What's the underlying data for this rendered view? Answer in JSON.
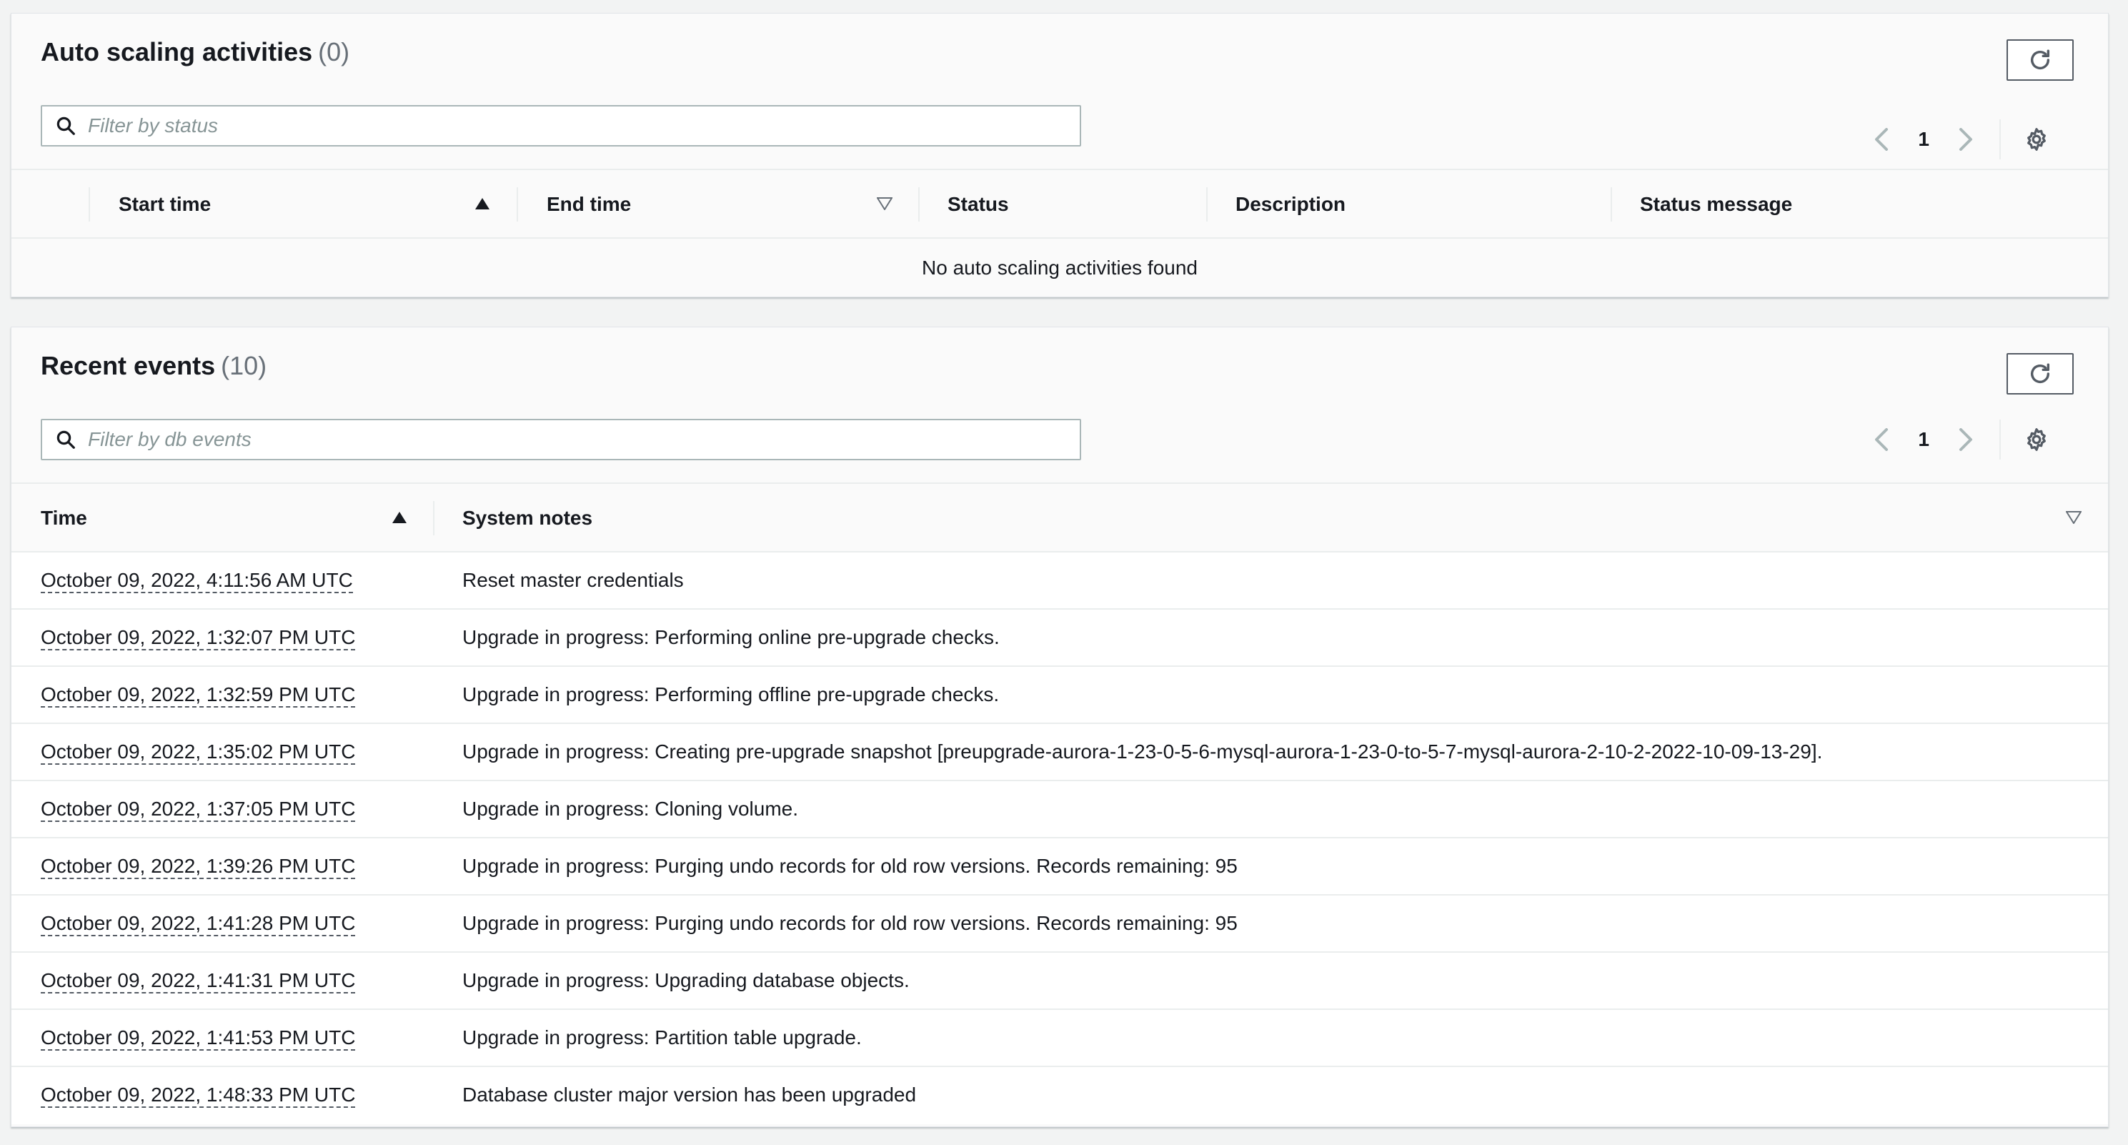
{
  "asg_panel": {
    "title": "Auto scaling activities",
    "count": "(0)",
    "filter_placeholder": "Filter by status",
    "page": "1",
    "columns": [
      "Start time",
      "End time",
      "Status",
      "Description",
      "Status message"
    ],
    "empty_message": "No auto scaling activities found"
  },
  "events_panel": {
    "title": "Recent events",
    "count": "(10)",
    "filter_placeholder": "Filter by db events",
    "page": "1",
    "columns": [
      "Time",
      "System notes"
    ],
    "rows": [
      {
        "time": "October 09, 2022, 4:11:56 AM UTC",
        "note": "Reset master credentials"
      },
      {
        "time": "October 09, 2022, 1:32:07 PM UTC",
        "note": "Upgrade in progress: Performing online pre-upgrade checks."
      },
      {
        "time": "October 09, 2022, 1:32:59 PM UTC",
        "note": "Upgrade in progress: Performing offline pre-upgrade checks."
      },
      {
        "time": "October 09, 2022, 1:35:02 PM UTC",
        "note": "Upgrade in progress: Creating pre-upgrade snapshot [preupgrade-aurora-1-23-0-5-6-mysql-aurora-1-23-0-to-5-7-mysql-aurora-2-10-2-2022-10-09-13-29]."
      },
      {
        "time": "October 09, 2022, 1:37:05 PM UTC",
        "note": "Upgrade in progress: Cloning volume."
      },
      {
        "time": "October 09, 2022, 1:39:26 PM UTC",
        "note": "Upgrade in progress: Purging undo records for old row versions. Records remaining: 95"
      },
      {
        "time": "October 09, 2022, 1:41:28 PM UTC",
        "note": "Upgrade in progress: Purging undo records for old row versions. Records remaining: 95"
      },
      {
        "time": "October 09, 2022, 1:41:31 PM UTC",
        "note": "Upgrade in progress: Upgrading database objects."
      },
      {
        "time": "October 09, 2022, 1:41:53 PM UTC",
        "note": "Upgrade in progress: Partition table upgrade."
      },
      {
        "time": "October 09, 2022, 1:48:33 PM UTC",
        "note": "Database cluster major version has been upgraded"
      }
    ]
  },
  "icons": {
    "refresh": "refresh-icon",
    "search": "search-icon",
    "prev": "chevron-left-icon",
    "next": "chevron-right-icon",
    "settings": "gear-icon",
    "sort_asc": "sort-ascending-icon",
    "sort_desc": "sort-descending-icon"
  },
  "colors": {
    "text": "#16191f",
    "muted": "#687078",
    "border": "#eaeded",
    "background": "#f2f3f3"
  }
}
